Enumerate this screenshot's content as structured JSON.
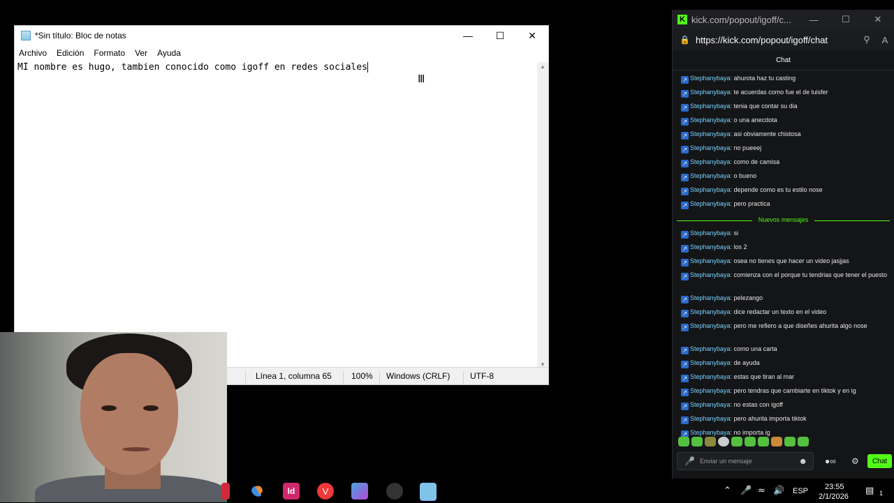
{
  "notepad": {
    "title": "*Sin título: Bloc de notas",
    "menu": [
      "Archivo",
      "Edición",
      "Formato",
      "Ver",
      "Ayuda"
    ],
    "content": "MI nombre es hugo, tambien conocido como igoff en redes sociales",
    "status": {
      "position": "Línea 1, columna 65",
      "zoom": "100%",
      "line_endings": "Windows (CRLF)",
      "encoding": "UTF-8"
    },
    "icons": {
      "minimize": "minimize-icon",
      "maximize": "maximize-icon",
      "close": "close-icon"
    }
  },
  "taskbar": {
    "language": "ESP",
    "time": "23:55",
    "date": "2/1/2026",
    "apps": [
      {
        "name": "copilot",
        "color": "#3a8ee6"
      },
      {
        "name": "indesign",
        "color": "#d0286e"
      },
      {
        "name": "vivaldi",
        "color": "#ef3939"
      },
      {
        "name": "m365-copilot",
        "color": "#4aa3df"
      },
      {
        "name": "obs",
        "color": "#333333"
      },
      {
        "name": "notepad",
        "color": "#7fc4e8"
      }
    ],
    "notification_count": "1"
  },
  "kick": {
    "window_title": "kick.com/popout/igoff/c...",
    "url": "https://kick.com/popout/igoff/chat",
    "header": "Chat",
    "accent": "#53fc18",
    "new_messages_label": "Nuevos mensajes",
    "messages_before": [
      {
        "user": "Stephanybaya:",
        "text": " ahurota haz tu casting"
      },
      {
        "user": "Stephanybaya:",
        "text": " te acuerdas como fue el de luisfer"
      },
      {
        "user": "Stephanybaya:",
        "text": " tenia que contar su dia"
      },
      {
        "user": "Stephanybaya:",
        "text": " o una anecdota"
      },
      {
        "user": "Stephanybaya:",
        "text": " asi obviamente chistosa"
      },
      {
        "user": "Stephanybaya:",
        "text": " no pueeej"
      },
      {
        "user": "Stephanybaya:",
        "text": " como de camisa"
      },
      {
        "user": "Stephanybaya:",
        "text": " o bueno"
      },
      {
        "user": "Stephanybaya:",
        "text": " depende como es tu estilo nose"
      },
      {
        "user": "Stephanybaya:",
        "text": " pero practica"
      }
    ],
    "messages_after": [
      {
        "user": "Stephanybaya:",
        "text": " si"
      },
      {
        "user": "Stephanybaya:",
        "text": " los 2"
      },
      {
        "user": "Stephanybaya:",
        "text": " osea no tienes que hacer un video jasjjas"
      },
      {
        "user": "Stephanybaya:",
        "text": " comienza con el porque tu tendrias que tener el puesto"
      },
      {
        "user": "Stephanybaya:",
        "text": " pelezango"
      },
      {
        "user": "Stephanybaya:",
        "text": " dice redactar un texto en el video"
      },
      {
        "user": "Stephanybaya:",
        "text": " pero me refiero a que diseñes ahurita algo nose"
      },
      {
        "user": "Stephanybaya:",
        "text": " como una carta"
      },
      {
        "user": "Stephanybaya:",
        "text": " de ayuda"
      },
      {
        "user": "Stephanybaya:",
        "text": " estas que tiran al mar"
      },
      {
        "user": "Stephanybaya:",
        "text": " pero tendras que cambiarte en tiktok y en ig"
      },
      {
        "user": "Stephanybaya:",
        "text": " no estas con igoff"
      },
      {
        "user": "Stephanybaya:",
        "text": " pero ahurita importa tiktok"
      },
      {
        "user": "Stephanybaya:",
        "text": " no importa ig"
      }
    ],
    "input_placeholder": "Enviar un mensaje",
    "send_label": "Chat"
  }
}
